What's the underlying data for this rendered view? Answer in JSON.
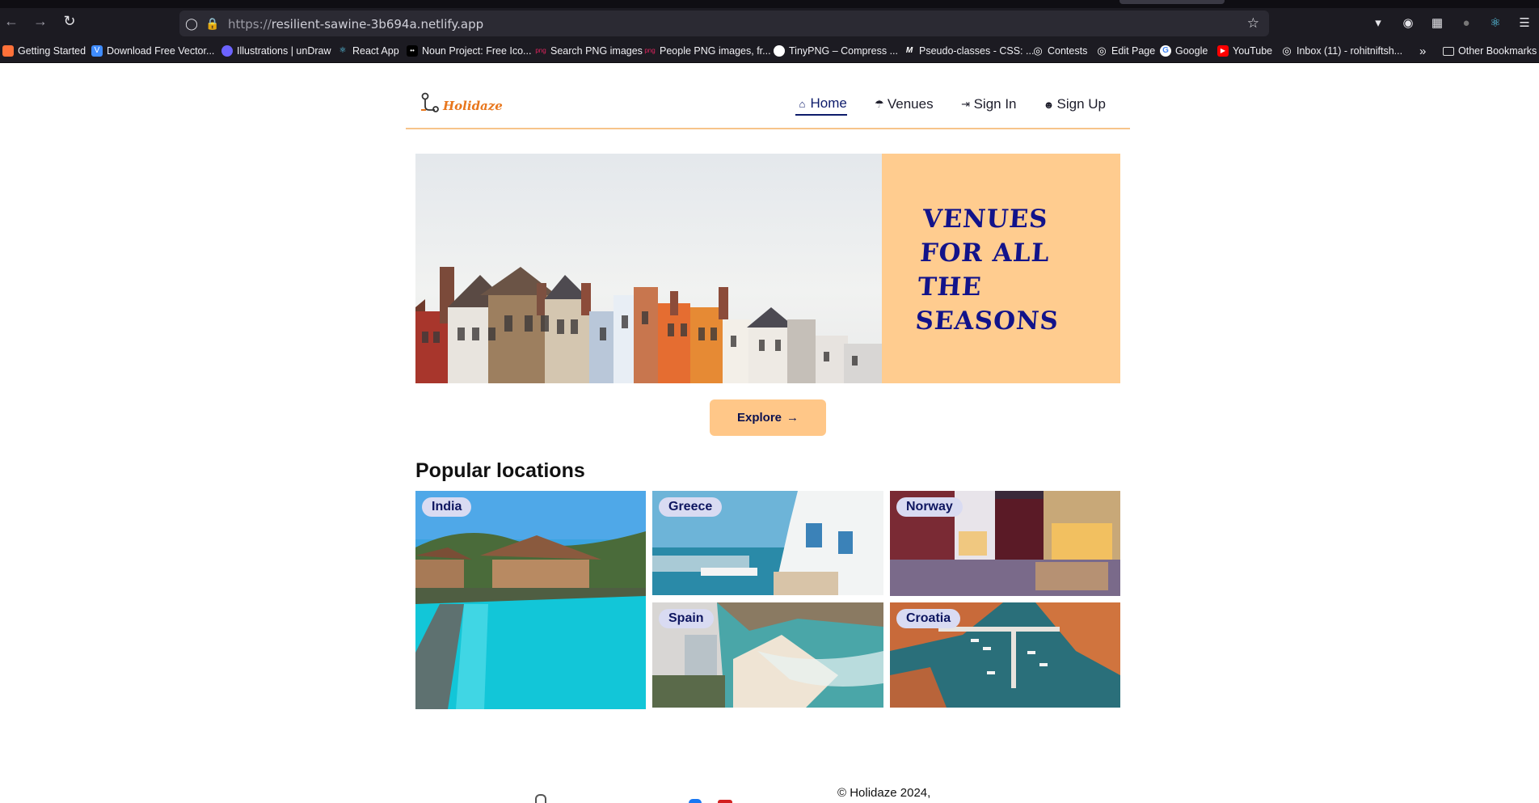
{
  "browser": {
    "url_prefix": "https://",
    "url_host": "resilient-sawine-3b694a.netlify.app",
    "nav_icons": [
      "back-icon",
      "forward-icon",
      "reload-icon"
    ],
    "toolbar_icons": [
      "pocket-icon",
      "account-icon",
      "extensions-icon",
      "sync-icon",
      "react-devtools-icon",
      "menu-icon"
    ],
    "bookmarks": [
      {
        "label": "Getting Started",
        "icon": "firefox-icon",
        "color": "#ff7139"
      },
      {
        "label": "Download Free Vector...",
        "icon": "vecteezy-icon",
        "color": "#3f8cff"
      },
      {
        "label": "Illustrations | unDraw",
        "icon": "undraw-icon",
        "color": "#6c63ff"
      },
      {
        "label": "React App",
        "icon": "react-icon",
        "color": "#61dafb"
      },
      {
        "label": "Noun Project: Free Ico...",
        "icon": "noun-project-icon",
        "color": "#000000"
      },
      {
        "label": "Search PNG images",
        "icon": "png-icon",
        "color": "#e0245e"
      },
      {
        "label": "People PNG images, fr...",
        "icon": "png-icon",
        "color": "#e0245e"
      },
      {
        "label": "TinyPNG – Compress ...",
        "icon": "tinypng-icon",
        "color": "#9ad14b"
      },
      {
        "label": "Pseudo-classes - CSS: ...",
        "icon": "mdn-icon",
        "color": "#ffffff"
      },
      {
        "label": "Contests",
        "icon": "globe-icon",
        "color": "#ffffff"
      },
      {
        "label": "Edit Page",
        "icon": "globe-icon",
        "color": "#ffffff"
      },
      {
        "label": "Google",
        "icon": "google-icon",
        "color": "#4285f4"
      },
      {
        "label": "YouTube",
        "icon": "youtube-icon",
        "color": "#ff0000"
      },
      {
        "label": "Inbox (11) - rohitniftsh...",
        "icon": "globe-icon",
        "color": "#ffffff"
      }
    ],
    "other_bookmarks": "Other Bookmarks"
  },
  "site": {
    "logo_text": "Holidaze",
    "nav": [
      {
        "label": "Home",
        "icon": "home-icon",
        "active": true
      },
      {
        "label": "Venues",
        "icon": "beach-umbrella-icon",
        "active": false
      },
      {
        "label": "Sign In",
        "icon": "sign-in-icon",
        "active": false
      },
      {
        "label": "Sign Up",
        "icon": "add-user-icon",
        "active": false
      }
    ],
    "accent_color": "#ffcc8f",
    "primary_color": "#12138a"
  },
  "hero": {
    "title": "Venues for all the seasons",
    "image": "colorful-townhouses-photo"
  },
  "explore": {
    "label": "Explore",
    "icon": "arrow-right-icon"
  },
  "popular": {
    "title": "Popular locations",
    "locations": [
      {
        "label": "India",
        "image": "pool-villa-photo"
      },
      {
        "label": "Greece",
        "image": "greek-coast-photo"
      },
      {
        "label": "Norway",
        "image": "bergen-street-photo"
      },
      {
        "label": "Spain",
        "image": "beach-cove-photo"
      },
      {
        "label": "Croatia",
        "image": "harbor-aerial-photo"
      }
    ]
  },
  "footer": {
    "copyright": "© Holidaze 2024,"
  }
}
